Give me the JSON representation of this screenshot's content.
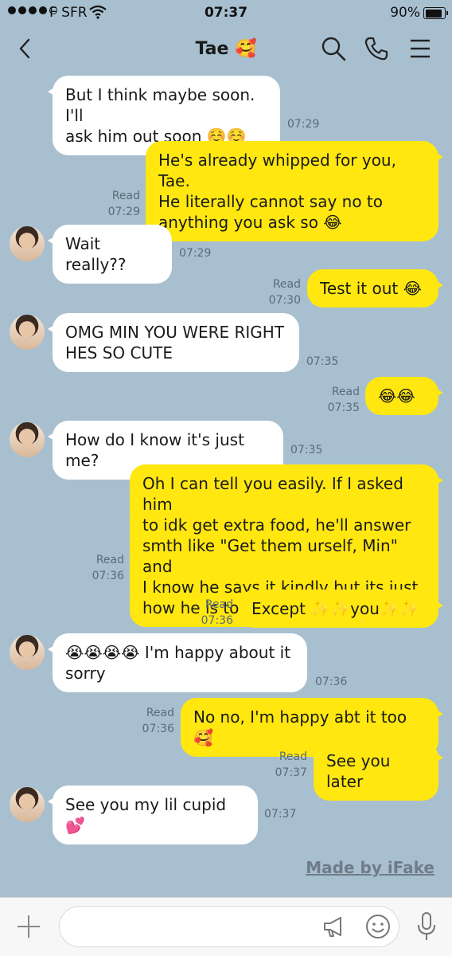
{
  "status": {
    "carrier": "F SFR",
    "time": "07:37",
    "battery": "90%"
  },
  "header": {
    "title": "Tae 🥰"
  },
  "messages": [
    {
      "dir": "in",
      "text": "But I think maybe soon. I'll\nask him out soon ☺️☺️",
      "time": "07:29",
      "avatar": false
    },
    {
      "dir": "out",
      "text": "He's already whipped for you, Tae.\nHe literally cannot say no to\nanything you ask so 😂",
      "read": "Read",
      "time": "07:29"
    },
    {
      "dir": "in",
      "text": "Wait really??",
      "time": "07:29",
      "avatar": true
    },
    {
      "dir": "out",
      "text": "Test it out 😂",
      "read": "Read",
      "time": "07:30"
    },
    {
      "dir": "in",
      "text": "OMG MIN YOU WERE RIGHT\nHES SO CUTE",
      "time": "07:35",
      "avatar": true
    },
    {
      "dir": "out",
      "text": "😂😂",
      "read": "Read",
      "time": "07:35"
    },
    {
      "dir": "in",
      "text": "How do I know it's just me?",
      "time": "07:35",
      "avatar": true
    },
    {
      "dir": "out",
      "text": "Oh I can tell you easily. If I asked him\nto idk get extra food, he'll answer\nsmth like \"Get them urself, Min\" and\nI know he says it kindly but its just\nhow he is to ppl",
      "read": "Read",
      "time": "07:36"
    },
    {
      "dir": "out",
      "text": "Except ✨✨you✨✨",
      "read": "Read",
      "time": "07:36"
    },
    {
      "dir": "in",
      "text": "😭😭😭😭 I'm happy about it\nsorry",
      "time": "07:36",
      "avatar": true
    },
    {
      "dir": "out",
      "text": "No no, I'm happy abt it too 🥰",
      "read": "Read",
      "time": "07:36"
    },
    {
      "dir": "out",
      "text": "See you later",
      "read": "Read",
      "time": "07:37"
    },
    {
      "dir": "in",
      "text": "See you my lil cupid 💕",
      "time": "07:37",
      "avatar": true
    }
  ],
  "watermark": "Made by iFake",
  "icons": {
    "back": "chevron-left-icon",
    "search": "search-icon",
    "call": "phone-icon",
    "menu": "menu-icon",
    "add": "plus-icon",
    "megaphone": "megaphone-icon",
    "emoji": "smiley-icon",
    "mic": "microphone-icon"
  },
  "colors": {
    "background": "#a8bfd0",
    "outgoing": "#ffe70f",
    "incoming": "#ffffff"
  }
}
